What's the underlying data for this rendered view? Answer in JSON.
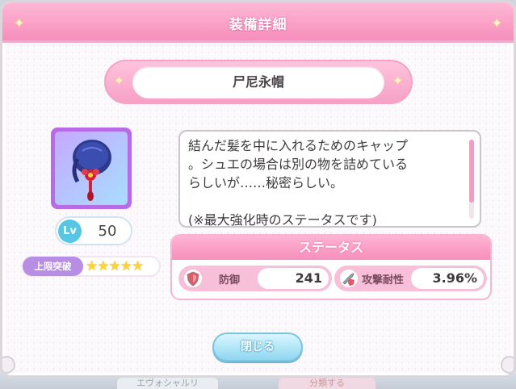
{
  "dialog": {
    "title": "装備詳細",
    "item_name": "尸尼永帽"
  },
  "item": {
    "icon": "blue-cap-with-red-flower-icon",
    "level_label": "Lv",
    "level": "50",
    "limit_break_label": "上限突破",
    "stars": "★★★★★",
    "description": "結んだ髪を中に入れるためのキャップ\n。シュエの場合は別の物を詰めている\nらしいが……秘密らしい。\n\n(※最大強化時のステータスです)"
  },
  "status": {
    "title": "ステータス",
    "stats": [
      {
        "icon": "shield-icon",
        "label": "防御",
        "value": "241"
      },
      {
        "icon": "sword-shield-icon",
        "label": "攻撃耐性",
        "value": "3.96%"
      }
    ]
  },
  "buttons": {
    "close": "閉じる"
  },
  "background_tabs": [
    "エヴォシャルリ",
    "分類する"
  ],
  "colors": {
    "accent_pink": "#f58ebb",
    "item_frame_purple": "#b86be6",
    "close_button_blue": "#8fd7f0"
  }
}
